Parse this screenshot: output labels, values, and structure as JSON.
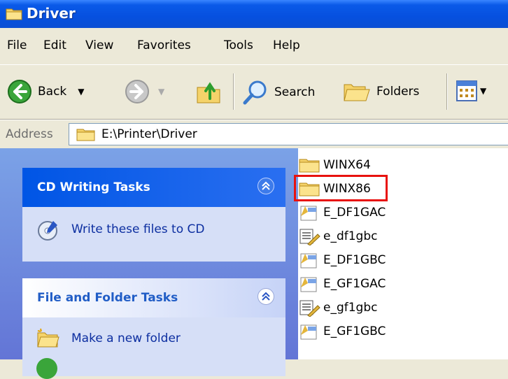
{
  "window": {
    "title": "Driver"
  },
  "menu": {
    "items": [
      "File",
      "Edit",
      "View",
      "Favorites",
      "Tools",
      "Help"
    ]
  },
  "toolbar": {
    "back": "Back",
    "search": "Search",
    "folders": "Folders"
  },
  "address": {
    "label": "Address",
    "value": "E:\\Printer\\Driver"
  },
  "tasks": {
    "cd": {
      "title": "CD Writing Tasks",
      "link": "Write these files to CD"
    },
    "folder": {
      "title": "File and Folder Tasks",
      "link": "Make a new folder"
    }
  },
  "files": [
    {
      "name": "WINX64",
      "type": "folder"
    },
    {
      "name": "WINX86",
      "type": "folder",
      "highlighted": true
    },
    {
      "name": "E_DF1GAC",
      "type": "setup"
    },
    {
      "name": "e_df1gbc",
      "type": "doc"
    },
    {
      "name": "E_DF1GBC",
      "type": "setup"
    },
    {
      "name": "E_GF1GAC",
      "type": "setup"
    },
    {
      "name": "e_gf1gbc",
      "type": "doc"
    },
    {
      "name": "E_GF1GBC",
      "type": "setup"
    }
  ],
  "colors": {
    "highlight": "#e8120e",
    "titlebar": "#0650df",
    "pane": "#6f8ddf"
  }
}
